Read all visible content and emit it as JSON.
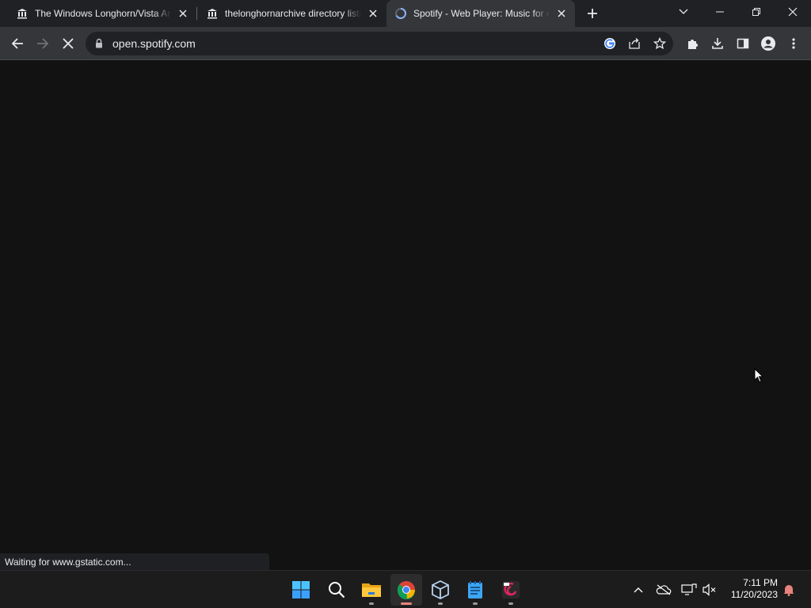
{
  "browser": {
    "tabs": [
      {
        "title": "The Windows Longhorn/Vista Archive",
        "icon": "archive-icon",
        "active": false
      },
      {
        "title": "thelonghornarchive directory listing",
        "icon": "archive-icon",
        "active": false
      },
      {
        "title": "Spotify - Web Player: Music for everyone",
        "icon": "loading-spinner-icon",
        "active": true
      }
    ],
    "url": "open.spotify.com",
    "status_text": "Waiting for www.gstatic.com..."
  },
  "taskbar": {
    "apps": [
      {
        "name": "start",
        "icon": "windows-start-icon"
      },
      {
        "name": "search",
        "icon": "search-icon"
      },
      {
        "name": "file-explorer",
        "icon": "folder-icon"
      },
      {
        "name": "chrome",
        "icon": "chrome-icon"
      },
      {
        "name": "virtualbox",
        "icon": "virtualbox-icon"
      },
      {
        "name": "notepad",
        "icon": "notepad-icon"
      },
      {
        "name": "debian-app",
        "icon": "debian-swirl-icon"
      }
    ],
    "time": "7:11 PM",
    "date": "11/20/2023"
  },
  "colors": {
    "titlebar": "#202124",
    "toolbar": "#35363a",
    "page_background": "#121212",
    "taskbar": "#1c1c1c",
    "active_indicator": "#e8837d"
  }
}
